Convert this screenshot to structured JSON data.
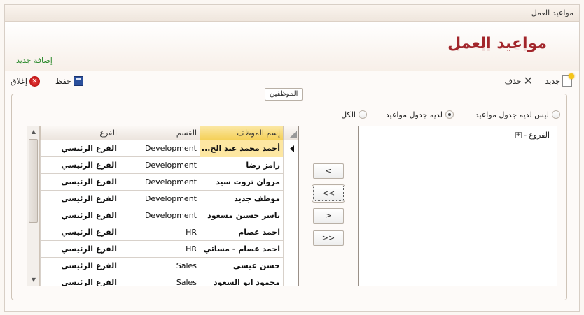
{
  "window": {
    "title": "مواعيد العمل"
  },
  "header": {
    "page_title": "مواعيد العمل",
    "add_new_link": "إضافة جديد"
  },
  "toolbar": {
    "new_label": "جديد",
    "delete_label": "حذف",
    "save_label": "حفظ",
    "close_label": "إغلاق"
  },
  "employees_group": {
    "legend": "الموظفين",
    "filters": [
      {
        "label": "ليس لديه جدول مواعيد",
        "checked": false
      },
      {
        "label": "لديه جدول مواعيد",
        "checked": true
      },
      {
        "label": "الكل",
        "checked": false
      }
    ]
  },
  "tree": {
    "root_label": "الفروع"
  },
  "move_buttons": {
    "add_one": "<",
    "add_all": "<<",
    "remove_one": ">",
    "remove_all": ">>"
  },
  "grid": {
    "columns": {
      "name": "إسم الموظف",
      "dept": "القسم",
      "branch": "الفرع"
    },
    "rows": [
      {
        "name": "أحمد محمد عبد الح...",
        "dept": "Development",
        "branch": "الفرع الرئيسي",
        "selected": true
      },
      {
        "name": "رامز رضا",
        "dept": "Development",
        "branch": "الفرع الرئيسي"
      },
      {
        "name": "مروان ثروت سيد",
        "dept": "Development",
        "branch": "الفرع الرئيسي"
      },
      {
        "name": "موظف جديد",
        "dept": "Development",
        "branch": "الفرع الرئيسي"
      },
      {
        "name": "ياسر حسين مسعود",
        "dept": "Development",
        "branch": "الفرع الرئيسي"
      },
      {
        "name": "احمد عصام",
        "dept": "HR",
        "branch": "الفرع الرئيسي"
      },
      {
        "name": "احمد عصام - مسائي",
        "dept": "HR",
        "branch": "الفرع الرئيسي"
      },
      {
        "name": "حسن عيسي",
        "dept": "Sales",
        "branch": "الفرع الرئيسي"
      },
      {
        "name": "محمود ابو السعود",
        "dept": "Sales",
        "branch": "الفرع الرئيسي"
      }
    ]
  }
}
